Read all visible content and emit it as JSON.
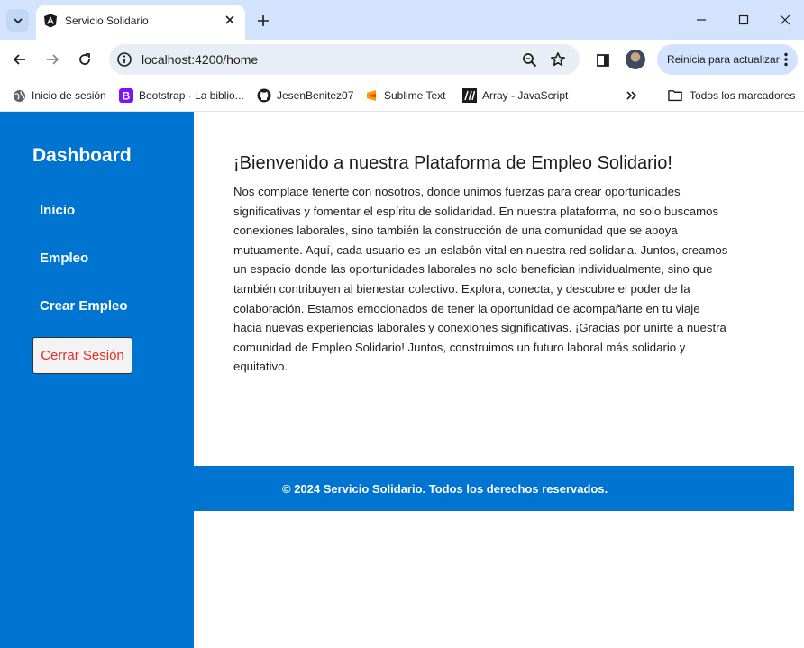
{
  "browser": {
    "tab": {
      "title": "Servicio Solidario",
      "favicon": "angular-icon"
    },
    "address": {
      "url": "localhost:4200/home"
    },
    "update_button": "Reinicia para actualizar",
    "bookmarks": [
      {
        "label": "Inicio de sesión",
        "icon": "globe-icon"
      },
      {
        "label": "Bootstrap · La biblio...",
        "icon": "bootstrap-icon"
      },
      {
        "label": "JesenBenitez07",
        "icon": "github-icon"
      },
      {
        "label": "Sublime Text",
        "icon": "sublime-icon"
      },
      {
        "label": "Array - JavaScript",
        "icon": "mdn-icon"
      }
    ],
    "all_bookmarks": "Todos los marcadores"
  },
  "sidebar": {
    "title": "Dashboard",
    "links": [
      "Inicio",
      "Empleo",
      "Crear Empleo"
    ],
    "logout": "Cerrar Sesión"
  },
  "main": {
    "title": "¡Bienvenido a nuestra Plataforma de Empleo Solidario!",
    "lines": [
      "Nos complace tenerte con nosotros, donde unimos fuerzas para crear oportunidades",
      "significativas y fomentar el espíritu de solidaridad. En nuestra plataforma, no solo buscamos",
      "conexiones laborales, sino también la construcción de una comunidad que se apoya",
      "mutuamente. Aquí, cada usuario es un eslabón vital en nuestra red solidaria. Juntos, creamos",
      "un espacio donde las oportunidades laborales no solo benefician individualmente, sino que",
      "también contribuyen al bienestar colectivo. Explora, conecta, y descubre el poder de la",
      "colaboración. Estamos emocionados de tener la oportunidad de acompañarte en tu viaje",
      "hacia nuevas experiencias laborales y conexiones significativas. ¡Gracias por unirte a nuestra",
      "comunidad de Empleo Solidario! Juntos, construimos un futuro laboral más solidario y",
      "equitativo."
    ]
  },
  "footer": {
    "text": "© 2024 Servicio Solidario. Todos los derechos reservados."
  },
  "colors": {
    "accent": "#0074d1",
    "logout_text": "#e0302a",
    "chrome": "#d3e3fd"
  }
}
